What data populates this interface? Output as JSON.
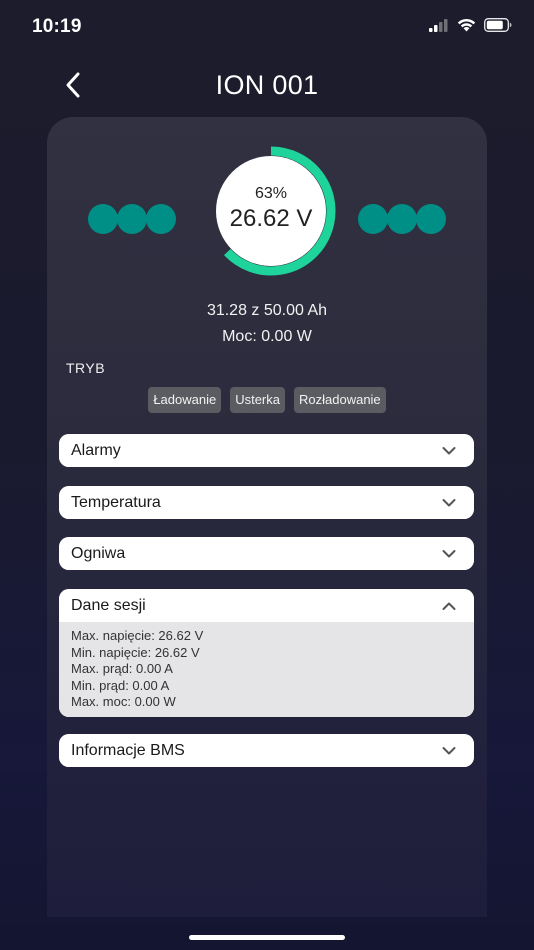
{
  "status_bar": {
    "time": "10:19"
  },
  "header": {
    "title": "ION 001"
  },
  "gauge": {
    "percent_text": "63%",
    "percent_value": 63,
    "voltage": "26.62 V",
    "color": "#1ed49a"
  },
  "summary": {
    "capacity": "31.28 z 50.00 Ah",
    "power": "Moc: 0.00 W"
  },
  "mode": {
    "label": "TRYB",
    "badges": [
      "Ładowanie",
      "Usterka",
      "Rozładowanie"
    ]
  },
  "sections": {
    "alarms": "Alarmy",
    "temperature": "Temperatura",
    "cells": "Ogniwa",
    "session": "Dane sesji",
    "bms": "Informacje BMS"
  },
  "session_data": [
    "Max. napięcie: 26.62 V",
    "Min. napięcie: 26.62 V",
    "Max. prąd: 0.00 A",
    "Min. prąd: 0.00 A",
    "Max. moc: 0.00 W"
  ],
  "colors": {
    "cell_indicator": "#008f86",
    "accent": "#1ed49a"
  },
  "icons": {
    "back": "chevron-left-icon",
    "collapsed": "chevron-down-icon",
    "expanded": "chevron-up-icon"
  }
}
